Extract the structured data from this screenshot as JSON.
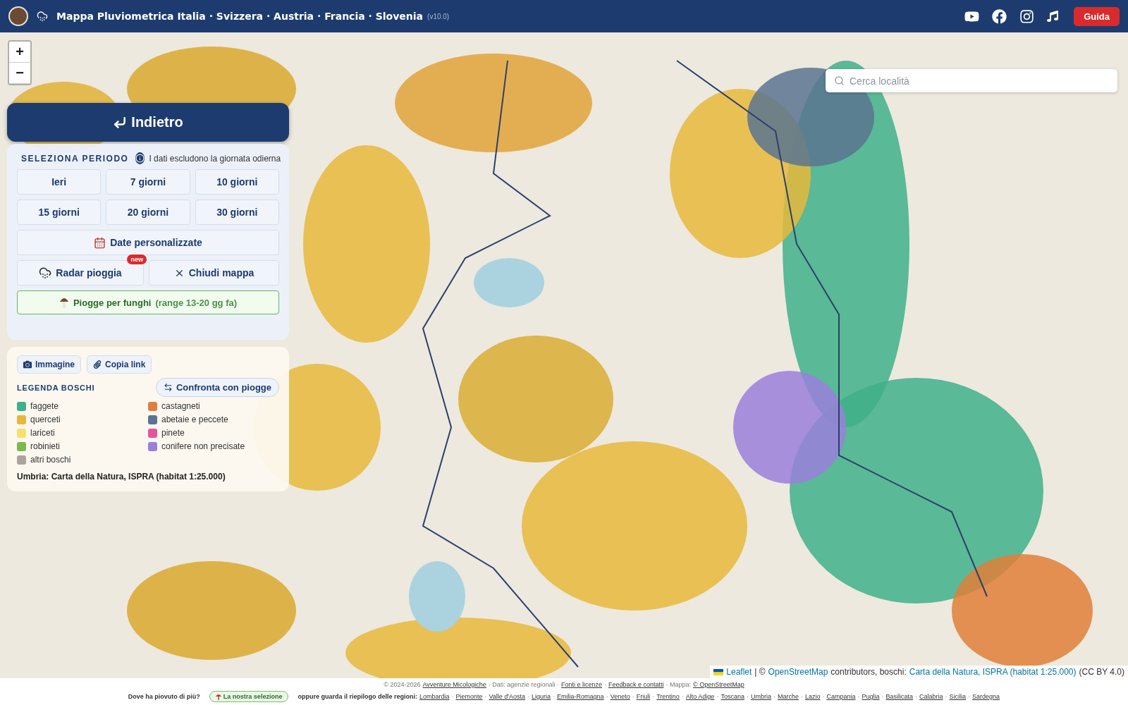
{
  "header": {
    "title": "Mappa Pluviometrica Italia · Svizzera · Austria · Francia · Slovenia",
    "version": "(v10.0)",
    "guide_button": "Guida"
  },
  "map": {
    "zoom_buttons": [
      "+",
      "−"
    ],
    "search": {
      "placeholder": "Cerca località"
    }
  },
  "period_panel": {
    "back_button": "Indietro",
    "title": "SELEZIONA PERIODO",
    "note": "I dati escludono la giornata odierna",
    "periods": [
      "Ieri",
      "7 giorni",
      "10 giorni",
      "15 giorni",
      "20 giorni",
      "30 giorni"
    ],
    "custom_dates": "Date personalizzate",
    "radar": {
      "label": "Radar pioggia",
      "badge": "new"
    },
    "close": "Chiudi mappa",
    "mushroom": {
      "label": "Piogge per funghi",
      "range": "(range 13-20 gg fa)"
    }
  },
  "legend": {
    "actions": [
      {
        "kind": "camera",
        "label": "Immagine"
      },
      {
        "kind": "link",
        "label": "Copia link"
      }
    ],
    "title": "LEGENDA BOSCHI",
    "compare_button": "Confronta con piogge",
    "items": [
      {
        "label": "faggete",
        "color": "#3fb08a"
      },
      {
        "label": "castagneti",
        "color": "#e07f3a"
      },
      {
        "label": "querceti",
        "color": "#e6b93c"
      },
      {
        "label": "abetaie e peccete",
        "color": "#5a7491"
      },
      {
        "label": "lariceti",
        "color": "#f7df70"
      },
      {
        "label": "pinete",
        "color": "#e5559a"
      },
      {
        "label": "robinieti",
        "color": "#7bb84e"
      },
      {
        "label": "conifere non precisate",
        "color": "#9a7fdc"
      },
      {
        "label": "altri boschi",
        "color": "#a9a59d"
      }
    ],
    "source": "Umbria: Carta della Natura, ISPRA (habitat 1:25.000)"
  },
  "attribution": [
    {
      "text": "Leaflet",
      "link": true
    },
    {
      "text": "| ©",
      "link": false
    },
    {
      "text": "OpenStreetMap",
      "link": true
    },
    {
      "text": "contributors, boschi:",
      "link": false
    },
    {
      "text": "Carta della Natura, ISPRA (habitat 1:25.000)",
      "link": true
    },
    {
      "text": "(CC BY 4.0)",
      "link": false
    }
  ],
  "footer": {
    "credits": [
      {
        "text": "© 2024-2026",
        "link": false
      },
      {
        "text": "Avventure Micologiche",
        "link": true
      },
      {
        "text": "· Dati: agenzie regionali ·",
        "link": false
      },
      {
        "text": "Fonti e licenze",
        "link": true
      },
      {
        "text": "·",
        "link": false
      },
      {
        "text": "Feedback e contatti",
        "link": true
      },
      {
        "text": "· Mappa:",
        "link": false
      },
      {
        "text": "© OpenStreetMap",
        "link": true
      }
    ],
    "question": "Dove ha piovuto di più?",
    "selection_button": "La nostra selezione",
    "regions_label": "oppure guarda il riepilogo delle regioni:",
    "separator": "·",
    "regions": [
      "Lombardia",
      "Piemonte",
      "Valle d'Aosta",
      "Liguria",
      "Emilia-Romagna",
      "Veneto",
      "Friuli",
      "Trentino",
      "Alto Adige",
      "Toscana",
      "Umbria",
      "Marche",
      "Lazio",
      "Campania",
      "Puglia",
      "Basilicata",
      "Calabria",
      "Sicilia",
      "Sardegna"
    ]
  }
}
